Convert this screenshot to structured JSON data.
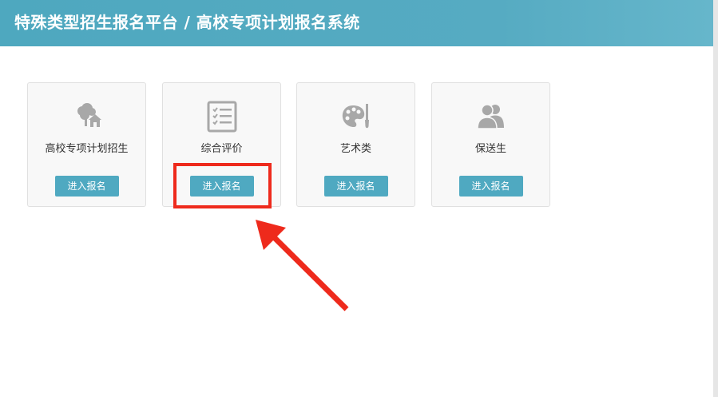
{
  "header": {
    "title": "特殊类型招生报名平台 / 高校专项计划报名系统"
  },
  "cards": [
    {
      "label": "高校专项计划招生",
      "button": "进入报名",
      "icon": "tree-house-icon"
    },
    {
      "label": "综合评价",
      "button": "进入报名",
      "icon": "checklist-icon"
    },
    {
      "label": "艺术类",
      "button": "进入报名",
      "icon": "palette-icon"
    },
    {
      "label": "保送生",
      "button": "进入报名",
      "icon": "users-icon"
    }
  ],
  "colors": {
    "header": "#4ea8bf",
    "button": "#4fa9c1",
    "highlight": "#ee2a1c",
    "card_bg": "#f8f8f8",
    "icon": "#a8a8a8"
  }
}
